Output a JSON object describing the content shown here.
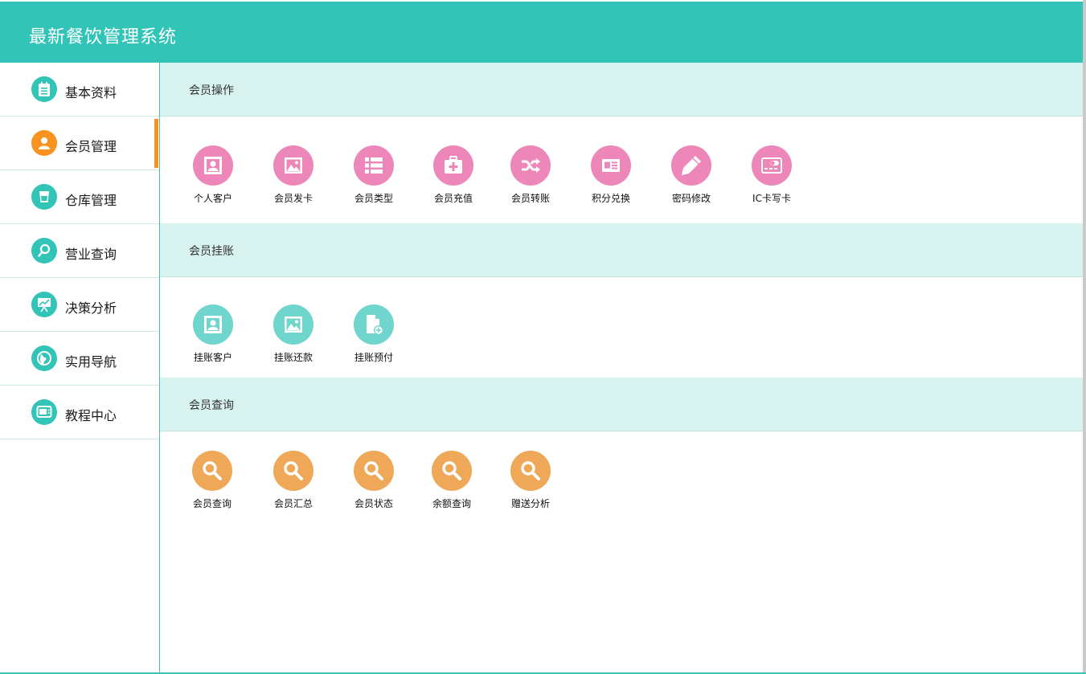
{
  "header": {
    "title": "最新餐饮管理系统"
  },
  "sidebar": {
    "items": [
      {
        "label": "基本资料",
        "icon": "notepad-icon"
      },
      {
        "label": "会员管理",
        "icon": "user-icon",
        "active": true
      },
      {
        "label": "仓库管理",
        "icon": "cup-icon"
      },
      {
        "label": "营业查询",
        "icon": "magnifier-icon"
      },
      {
        "label": "决策分析",
        "icon": "presentation-chart-icon"
      },
      {
        "label": "实用导航",
        "icon": "globe-icon"
      },
      {
        "label": "教程中心",
        "icon": "tv-icon"
      }
    ]
  },
  "sections": [
    {
      "title": "会员操作",
      "color": "#ee87b9",
      "tiles": [
        {
          "label": "个人客户",
          "icon": "portrait-icon"
        },
        {
          "label": "会员发卡",
          "icon": "image-icon"
        },
        {
          "label": "会员类型",
          "icon": "list-icon"
        },
        {
          "label": "会员充值",
          "icon": "first-aid-icon"
        },
        {
          "label": "会员转账",
          "icon": "shuffle-icon"
        },
        {
          "label": "积分兑换",
          "icon": "id-card-icon"
        },
        {
          "label": "密码修改",
          "icon": "pencil-icon"
        },
        {
          "label": "IC卡写卡",
          "icon": "ic-card-icon"
        }
      ]
    },
    {
      "title": "会员挂账",
      "color": "#70d6cd",
      "tiles": [
        {
          "label": "挂账客户",
          "icon": "portrait-icon"
        },
        {
          "label": "挂账还款",
          "icon": "image-icon"
        },
        {
          "label": "挂账预付",
          "icon": "add-document-icon"
        }
      ]
    },
    {
      "title": "会员查询",
      "color": "#eea858",
      "tiles": [
        {
          "label": "会员查询",
          "icon": "search-icon"
        },
        {
          "label": "会员汇总",
          "icon": "search-icon"
        },
        {
          "label": "会员状态",
          "icon": "search-icon"
        },
        {
          "label": "余额查询",
          "icon": "search-icon"
        },
        {
          "label": "赠送分析",
          "icon": "search-icon"
        }
      ]
    }
  ]
}
